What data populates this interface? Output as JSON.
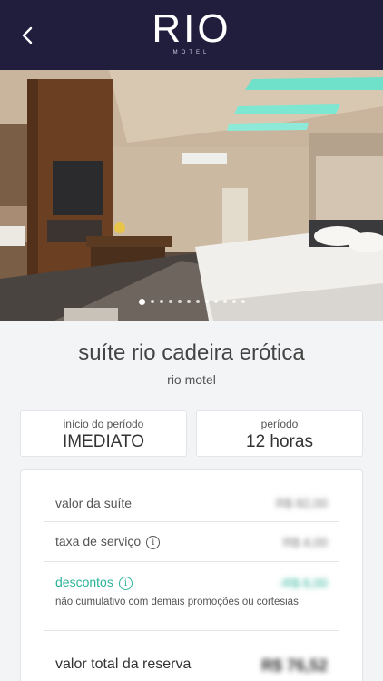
{
  "header": {
    "logo_main": "RIO",
    "logo_sub": "MOTEL",
    "background": "#211d3d"
  },
  "gallery": {
    "image_count": 12,
    "active_index": 0
  },
  "suite": {
    "title": "suíte rio cadeira erótica",
    "motel": "rio motel"
  },
  "period": {
    "start_label": "início do período",
    "start_value": "IMEDIATO",
    "duration_label": "período",
    "duration_value": "12 horas"
  },
  "pricing": {
    "suite_label": "valor da suíte",
    "suite_value": "R$ 82,00",
    "service_label": "taxa de serviço",
    "service_value": "R$ 4,00",
    "discount_label": "descontos",
    "discount_value": "-R$ 6,00",
    "discount_note": "não cumulativo com demais promoções ou cortesias",
    "total_label": "valor total da reserva",
    "total_value": "R$ 76,52",
    "accent": "#2ab397"
  }
}
